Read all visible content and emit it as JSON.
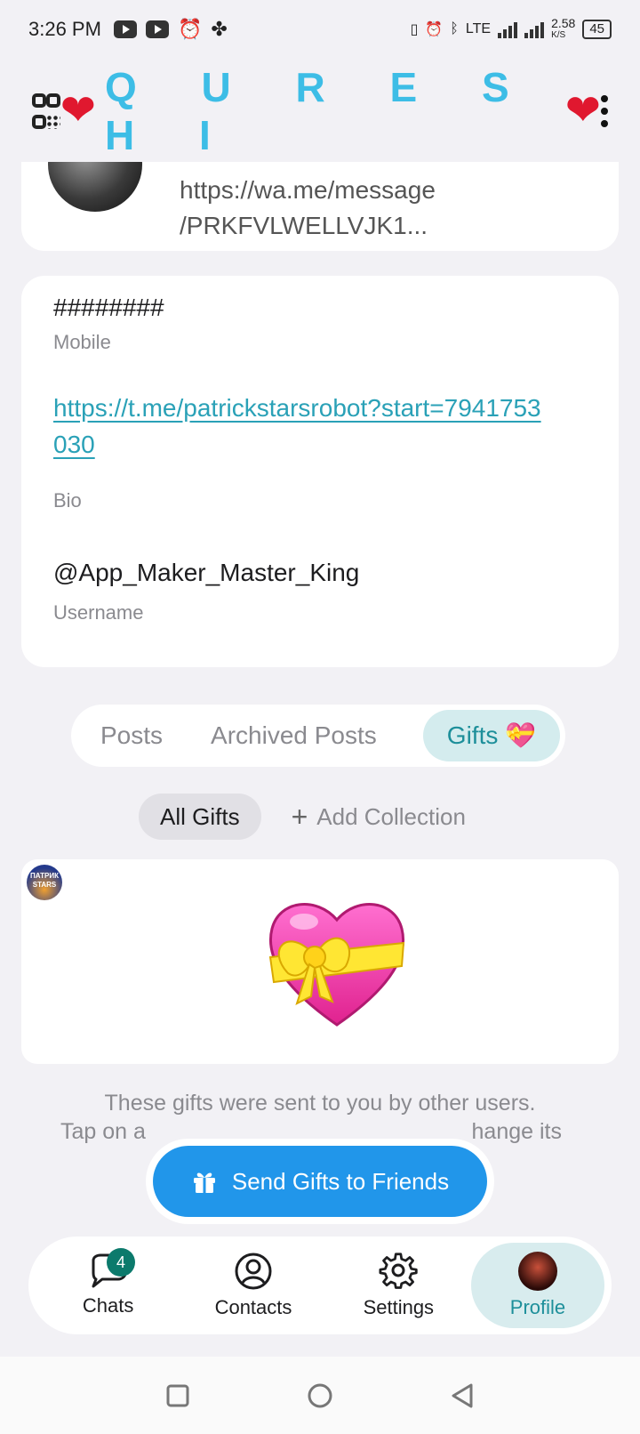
{
  "status_bar": {
    "time": "3:26 PM",
    "network": "LTE",
    "speed": "2.58",
    "speed_unit": "K/S",
    "battery": "45"
  },
  "app_bar": {
    "title": "Q U R E S H I",
    "heart_left": "❤",
    "heart_right": "❤"
  },
  "profile_card": {
    "link_line1": "https://wa.me/message",
    "link_line2": "/PRKFVLWELLVJK1..."
  },
  "info": {
    "mobile_value": "########",
    "mobile_label": "Mobile",
    "bio_value": "https://t.me/patrickstarsrobot?start=7941753030",
    "bio_label": "Bio",
    "username_value": "@App_Maker_Master_King",
    "username_label": "Username"
  },
  "tabs": [
    {
      "label": "Posts"
    },
    {
      "label": "Archived Posts"
    },
    {
      "label": "Gifts 💝",
      "active": true
    }
  ],
  "collections": {
    "all_gifts": "All Gifts",
    "add_collection": "Add Collection"
  },
  "gift": {
    "emoji": "💝",
    "sender_badge": "ПАТРИК STARS"
  },
  "caption_line1": "These gifts were sent to you by other users.",
  "caption_line2_left": "Tap on a",
  "caption_line2_right": "hange its",
  "send_button": "Send Gifts to Friends",
  "bottom_nav": [
    {
      "label": "Chats",
      "badge": "4"
    },
    {
      "label": "Contacts"
    },
    {
      "label": "Settings"
    },
    {
      "label": "Profile",
      "active": true
    }
  ]
}
